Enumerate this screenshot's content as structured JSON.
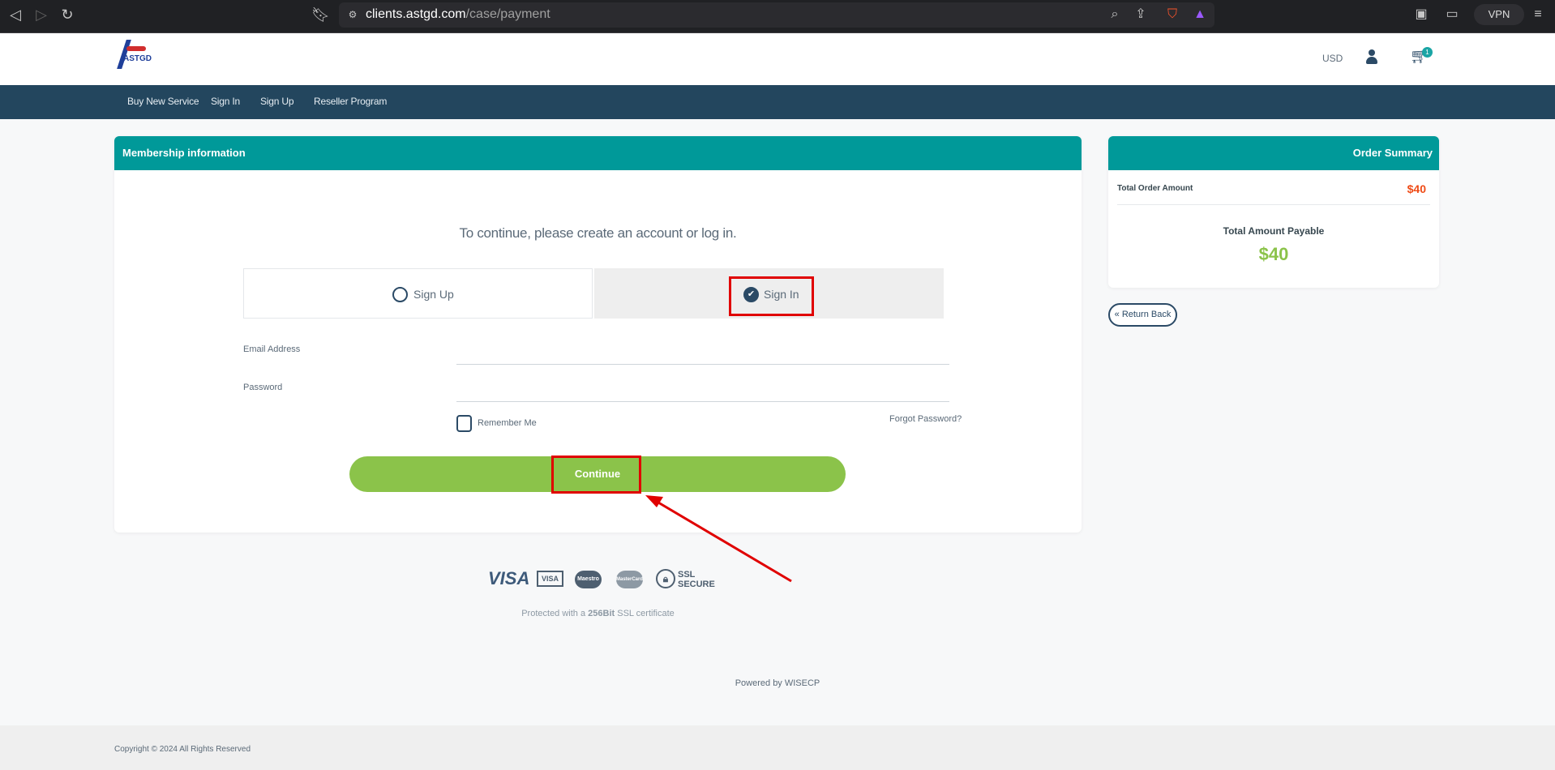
{
  "browser": {
    "url_host": "clients.astgd.com",
    "url_path": "/case/payment",
    "vpn_label": "VPN"
  },
  "header": {
    "logo_text": "ASTGD",
    "currency": "USD",
    "cart_count": "1"
  },
  "nav": {
    "items": [
      "Buy New Service",
      "Sign In",
      "Sign Up",
      "Reseller Program"
    ]
  },
  "membership": {
    "title": "Membership information",
    "intro": "To continue, please create an account or log in.",
    "tab_signup": "Sign Up",
    "tab_signin": "Sign In",
    "selected_tab": "Sign In",
    "email_label": "Email Address",
    "email_value": "",
    "password_label": "Password",
    "password_value": "",
    "remember_label": "Remember Me",
    "remember_checked": false,
    "forgot_label": "Forgot Password?",
    "continue_label": "Continue"
  },
  "summary": {
    "title": "Order Summary",
    "total_order_label": "Total Order Amount",
    "total_order_value": "$40",
    "payable_label": "Total Amount Payable",
    "payable_value": "$40"
  },
  "return_label": "« Return Back",
  "payment": {
    "logos": [
      "VISA",
      "VISA",
      "Maestro",
      "MasterCard",
      "SSL SECURE"
    ],
    "ssl_note_prefix": "Protected with a ",
    "ssl_note_bold": "256Bit",
    "ssl_note_suffix": " SSL certificate"
  },
  "powered_by": "Powered by WISECP",
  "copyright": "Copyright © 2024 All Rights Reserved",
  "colors": {
    "teal": "#009999",
    "nav": "#23465e",
    "green": "#8bc34a",
    "price": "#ef4b16",
    "annotation": "#e00000"
  }
}
